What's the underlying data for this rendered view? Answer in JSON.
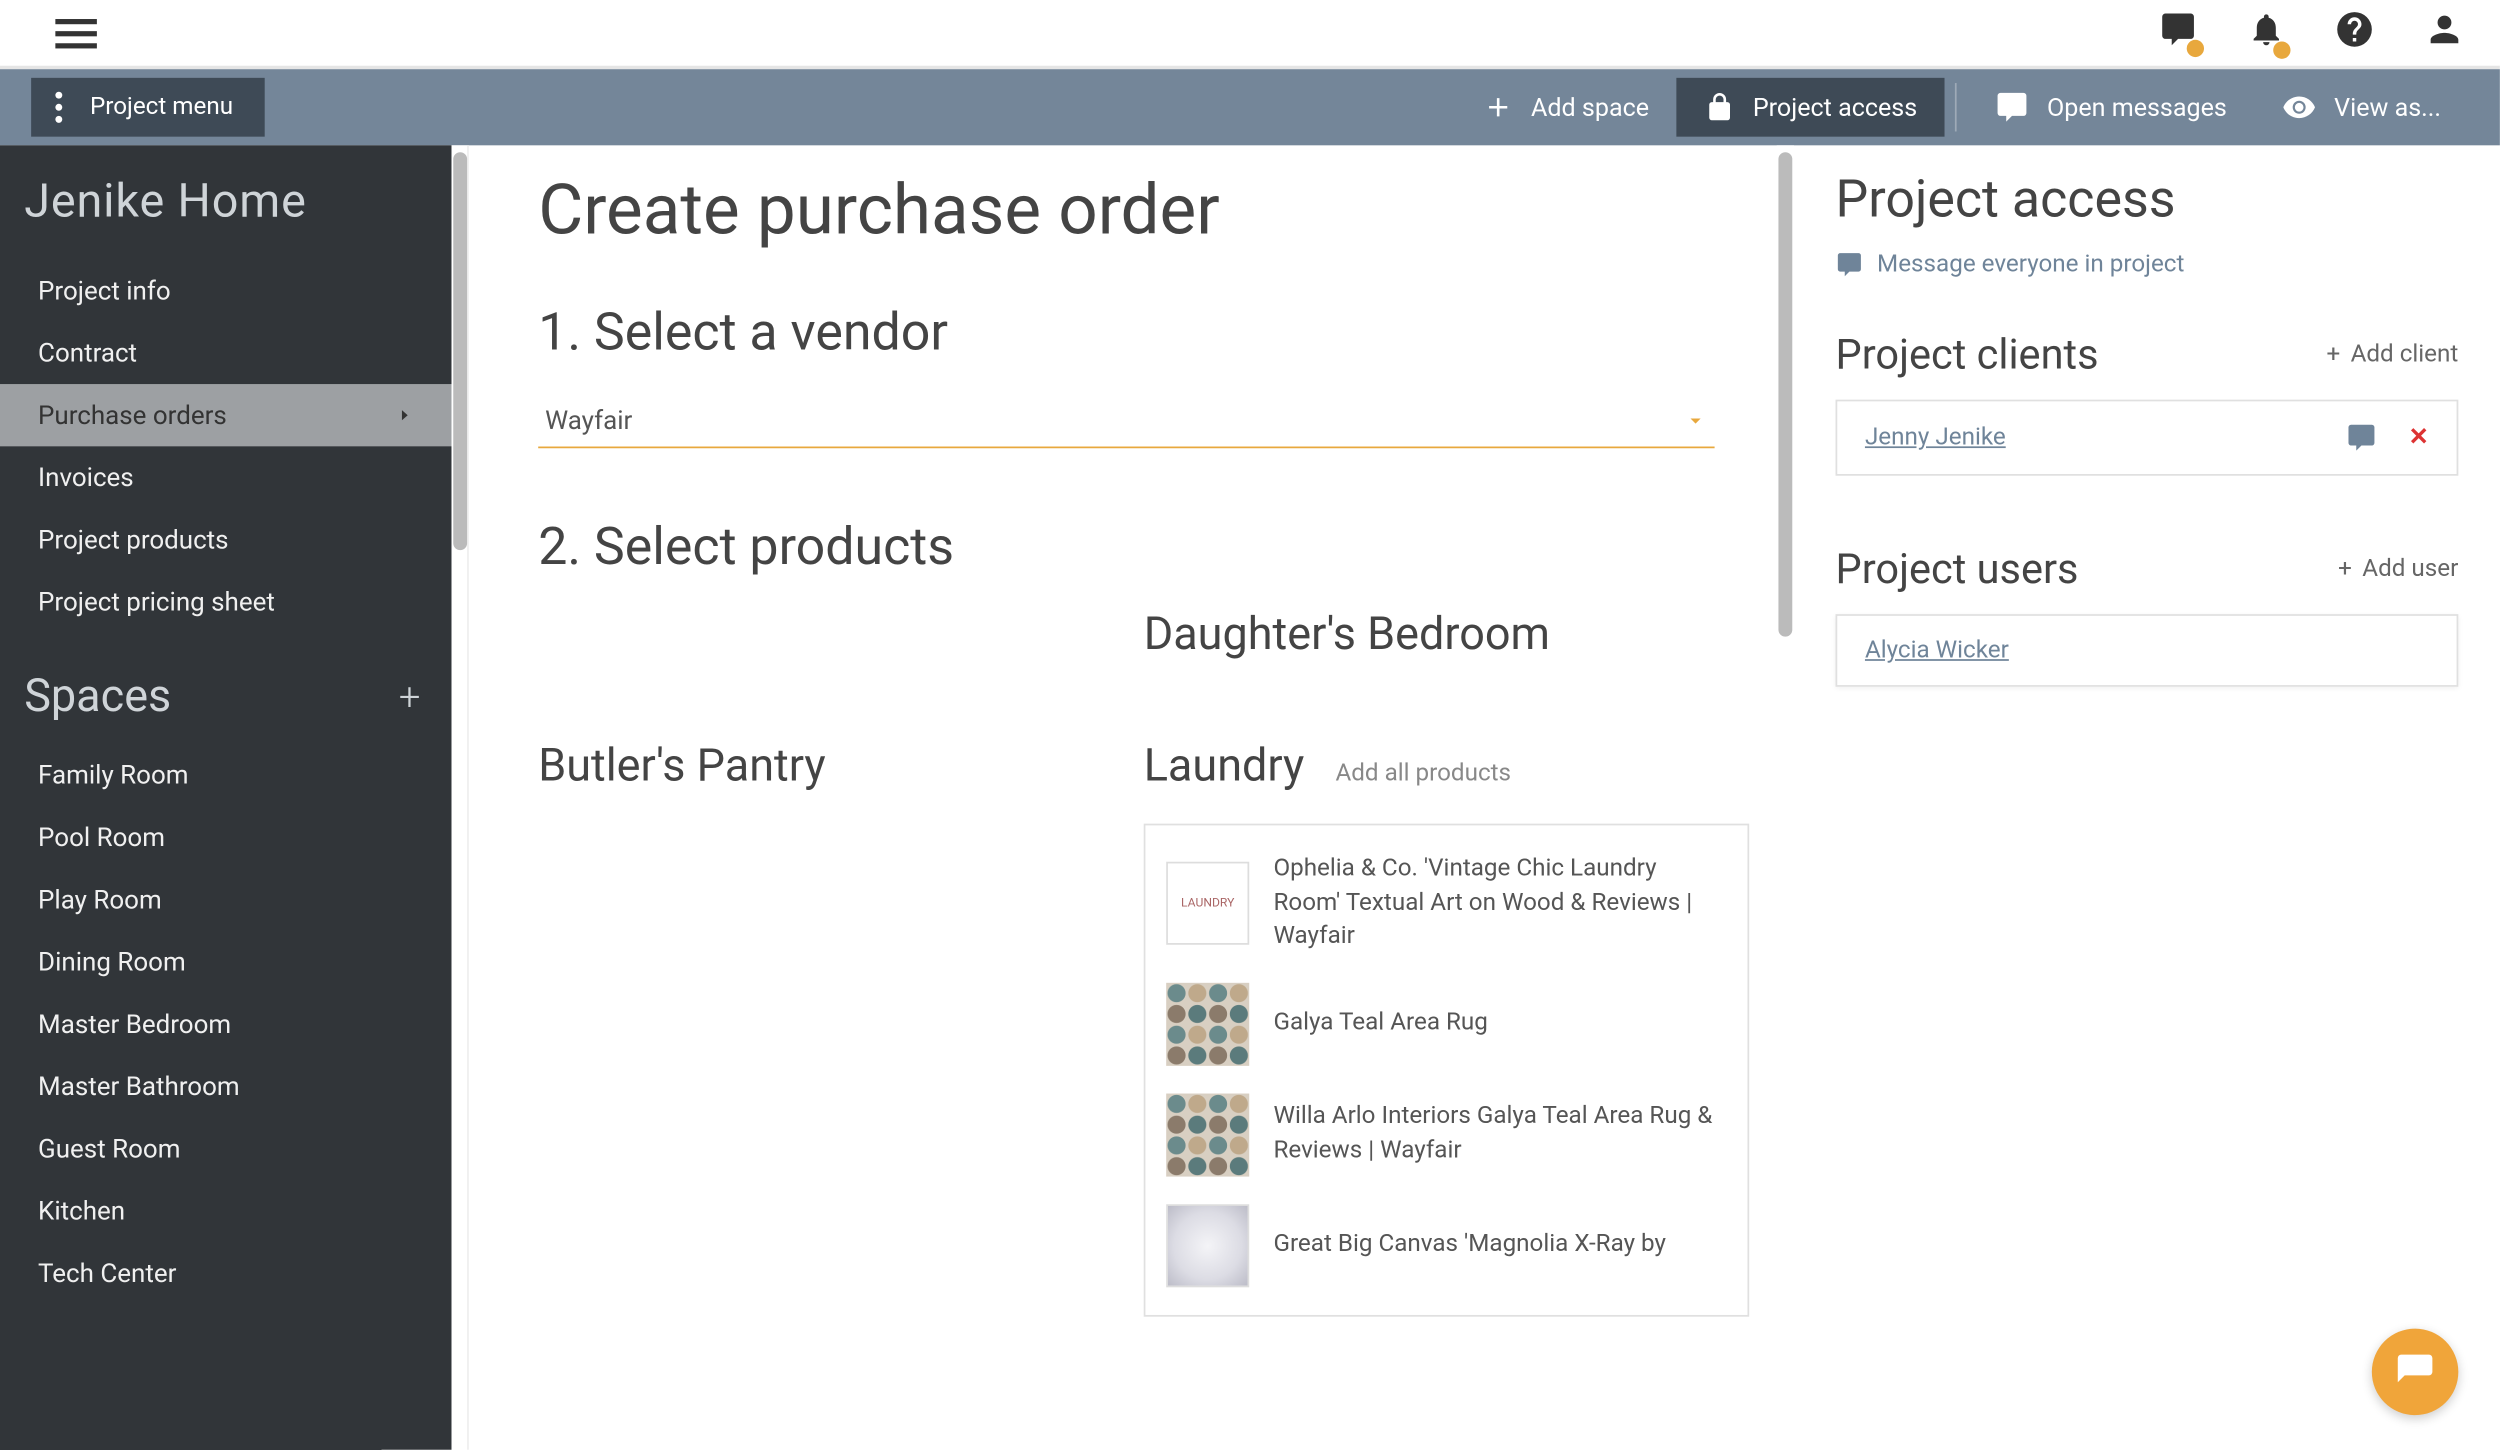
{
  "topbar": {
    "icons": [
      "hamburger",
      "chat",
      "bell",
      "help",
      "account"
    ]
  },
  "actionbar": {
    "project_menu": "Project menu",
    "add_space": "Add space",
    "project_access": "Project access",
    "open_messages": "Open messages",
    "view_as": "View as..."
  },
  "sidebar": {
    "project_title": "Jenike Home",
    "nav": [
      {
        "label": "Project info",
        "active": false
      },
      {
        "label": "Contract",
        "active": false
      },
      {
        "label": "Purchase orders",
        "active": true
      },
      {
        "label": "Invoices",
        "active": false
      },
      {
        "label": "Project products",
        "active": false
      },
      {
        "label": "Project pricing sheet",
        "active": false
      }
    ],
    "spaces_header": "Spaces",
    "spaces": [
      "Family Room",
      "Pool Room",
      "Play Room",
      "Dining Room",
      "Master Bedroom",
      "Master Bathroom",
      "Guest Room",
      "Kitchen",
      "Tech Center"
    ]
  },
  "main": {
    "title": "Create purchase order",
    "step1_title": "1. Select a vendor",
    "vendor_selected": "Wayfair",
    "step2_title": "2. Select products",
    "space_daughter": "Daughter's Bedroom",
    "space_butler": "Butler's Pantry",
    "space_laundry": "Laundry",
    "add_all": "Add all products",
    "products": [
      {
        "name": "Ophelia & Co. 'Vintage Chic Laundry Room' Textual Art on Wood & Reviews | Wayfair",
        "thumb": "art"
      },
      {
        "name": "Galya Teal Area Rug",
        "thumb": "rug1"
      },
      {
        "name": "Willa Arlo Interiors Galya Teal Area Rug & Reviews | Wayfair",
        "thumb": "rug2"
      },
      {
        "name": "Great Big Canvas 'Magnolia X-Ray by",
        "thumb": "xray"
      }
    ]
  },
  "right": {
    "title": "Project access",
    "message_all": "Message everyone in project",
    "clients_title": "Project clients",
    "add_client": "Add client",
    "clients": [
      {
        "name": "Jenny Jenike"
      }
    ],
    "users_title": "Project users",
    "add_user": "Add user",
    "users": [
      {
        "name": "Alycia Wicker"
      }
    ]
  }
}
